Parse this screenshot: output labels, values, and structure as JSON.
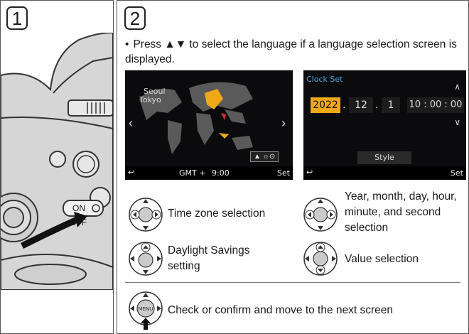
{
  "step1": {
    "number": "1",
    "switch_on": "ON",
    "switch_off": "OFF"
  },
  "step2": {
    "number": "2",
    "bullet": "•",
    "instruction": "Press ▲▼ to select the language if a language selection screen is displayed.",
    "world_screen": {
      "city_1": "Seoul",
      "city_2": "Tokyo",
      "dst_badge": "▲ ☼⊙",
      "gmt": "GMT +",
      "gmt_offset": "9:00",
      "set": "Set",
      "back_icon": "↩"
    },
    "clock_screen": {
      "title": "Clock Set",
      "year": "2022",
      "month": "12",
      "day": "1",
      "time": "10 : 00 : 00",
      "style": "Style",
      "set": "Set",
      "back_icon": "↩"
    },
    "controls": {
      "time_zone": "Time zone selection",
      "daylight": "Daylight Savings setting",
      "ymd": "Year, month, day, hour, minute, and second selection",
      "value": "Value selection",
      "confirm": "Check or confirm and move to the next screen",
      "dial_center": "MENU SET"
    },
    "colors": {
      "highlight": "#f0a818",
      "screen_bg": "#0b0b0d",
      "land": "#5a5a5a",
      "clock_title": "#4aa3e0"
    }
  }
}
